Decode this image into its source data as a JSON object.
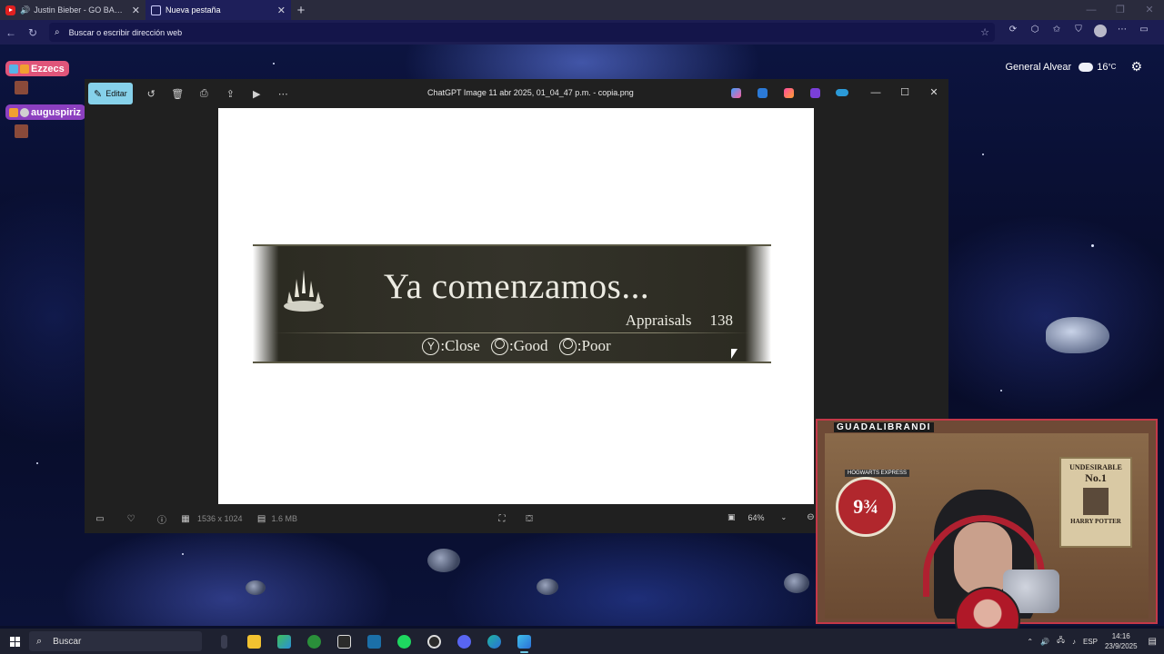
{
  "browser": {
    "tabs": [
      {
        "title": "Justin Bieber - GO BABY (Au",
        "favicon": "youtube-icon",
        "audio": true,
        "active": false
      },
      {
        "title": "Nueva pestaña",
        "favicon": "page-icon",
        "audio": false,
        "active": true
      }
    ],
    "address_placeholder": "Buscar o escribir dirección web"
  },
  "desktop": {
    "weather": {
      "location": "General Alvear",
      "temp": "16",
      "unit": "°C"
    }
  },
  "chat": [
    {
      "user": "Ezzecs",
      "color": "#e0557a"
    },
    {
      "user": "auguspiriz",
      "color": "#8c3fc0"
    }
  ],
  "photos": {
    "edit_label": "Editar",
    "title": "ChatGPT Image 11 abr 2025, 01_04_47 p.m. - copia.png",
    "dimensions": "1536 x 1024",
    "filesize": "1.6 MB",
    "zoom": "64%"
  },
  "image": {
    "heading": "Ya comenzamos...",
    "appraisals_label": "Appraisals",
    "appraisals_value": "138",
    "actions": [
      {
        "glyph": "Y",
        "label": ":Close"
      },
      {
        "glyph": "",
        "label": ":Good"
      },
      {
        "glyph": "",
        "label": ":Poor"
      }
    ]
  },
  "webcam": {
    "streamer": "GUADALIBRANDI",
    "poster_left": "9¾",
    "poster_left_top": "HOGWARTS EXPRESS",
    "poster_right": {
      "line1": "UNDESIRABLE",
      "line2": "No.1",
      "line3": "HARRY POTTER"
    }
  },
  "taskbar": {
    "search_label": "Buscar",
    "language": "ESP",
    "time": "14:16",
    "date": "23/9/2025"
  }
}
